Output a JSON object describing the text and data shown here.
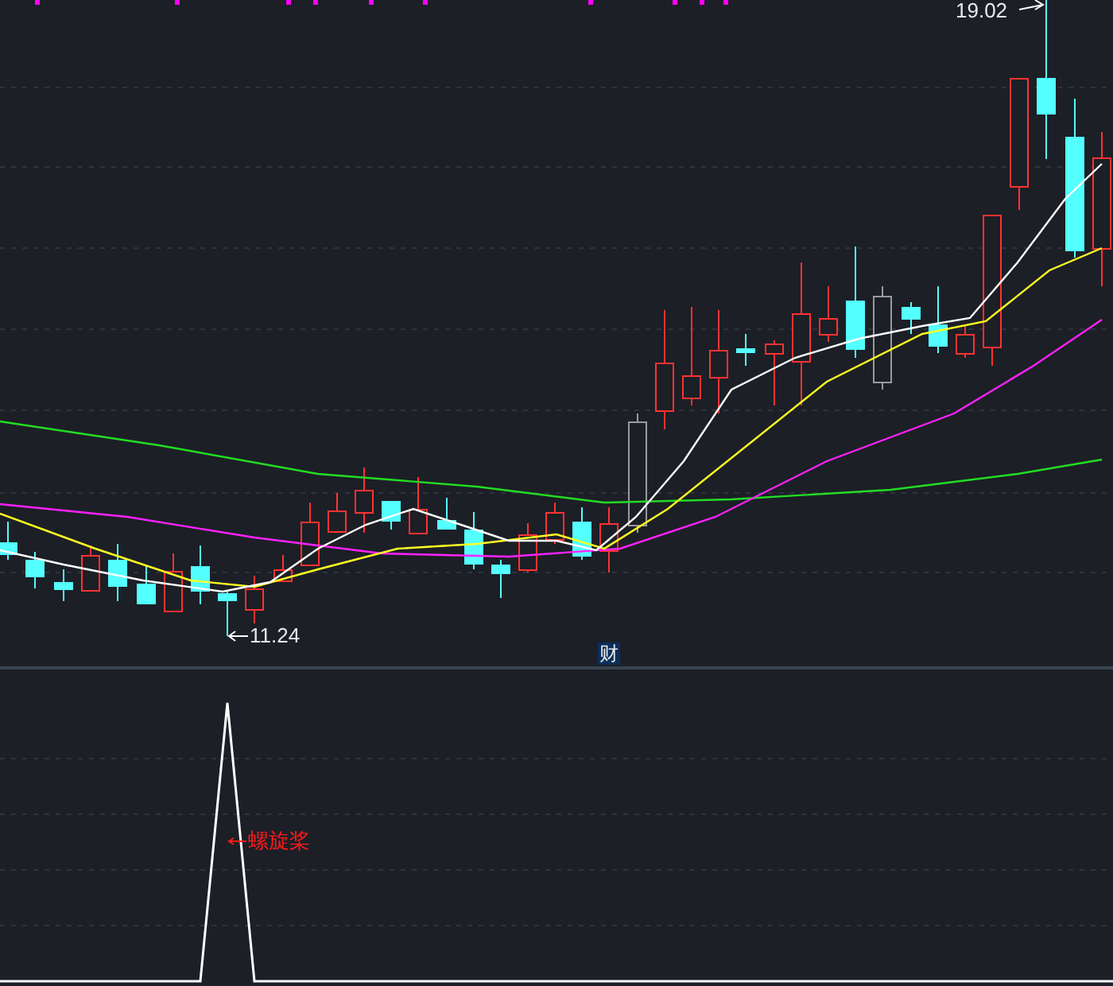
{
  "price_chart": {
    "high_label": "19.02",
    "low_label": "11.24",
    "marker": "财"
  },
  "indicator_panel": {
    "signal_label": "螺旋桨"
  }
}
